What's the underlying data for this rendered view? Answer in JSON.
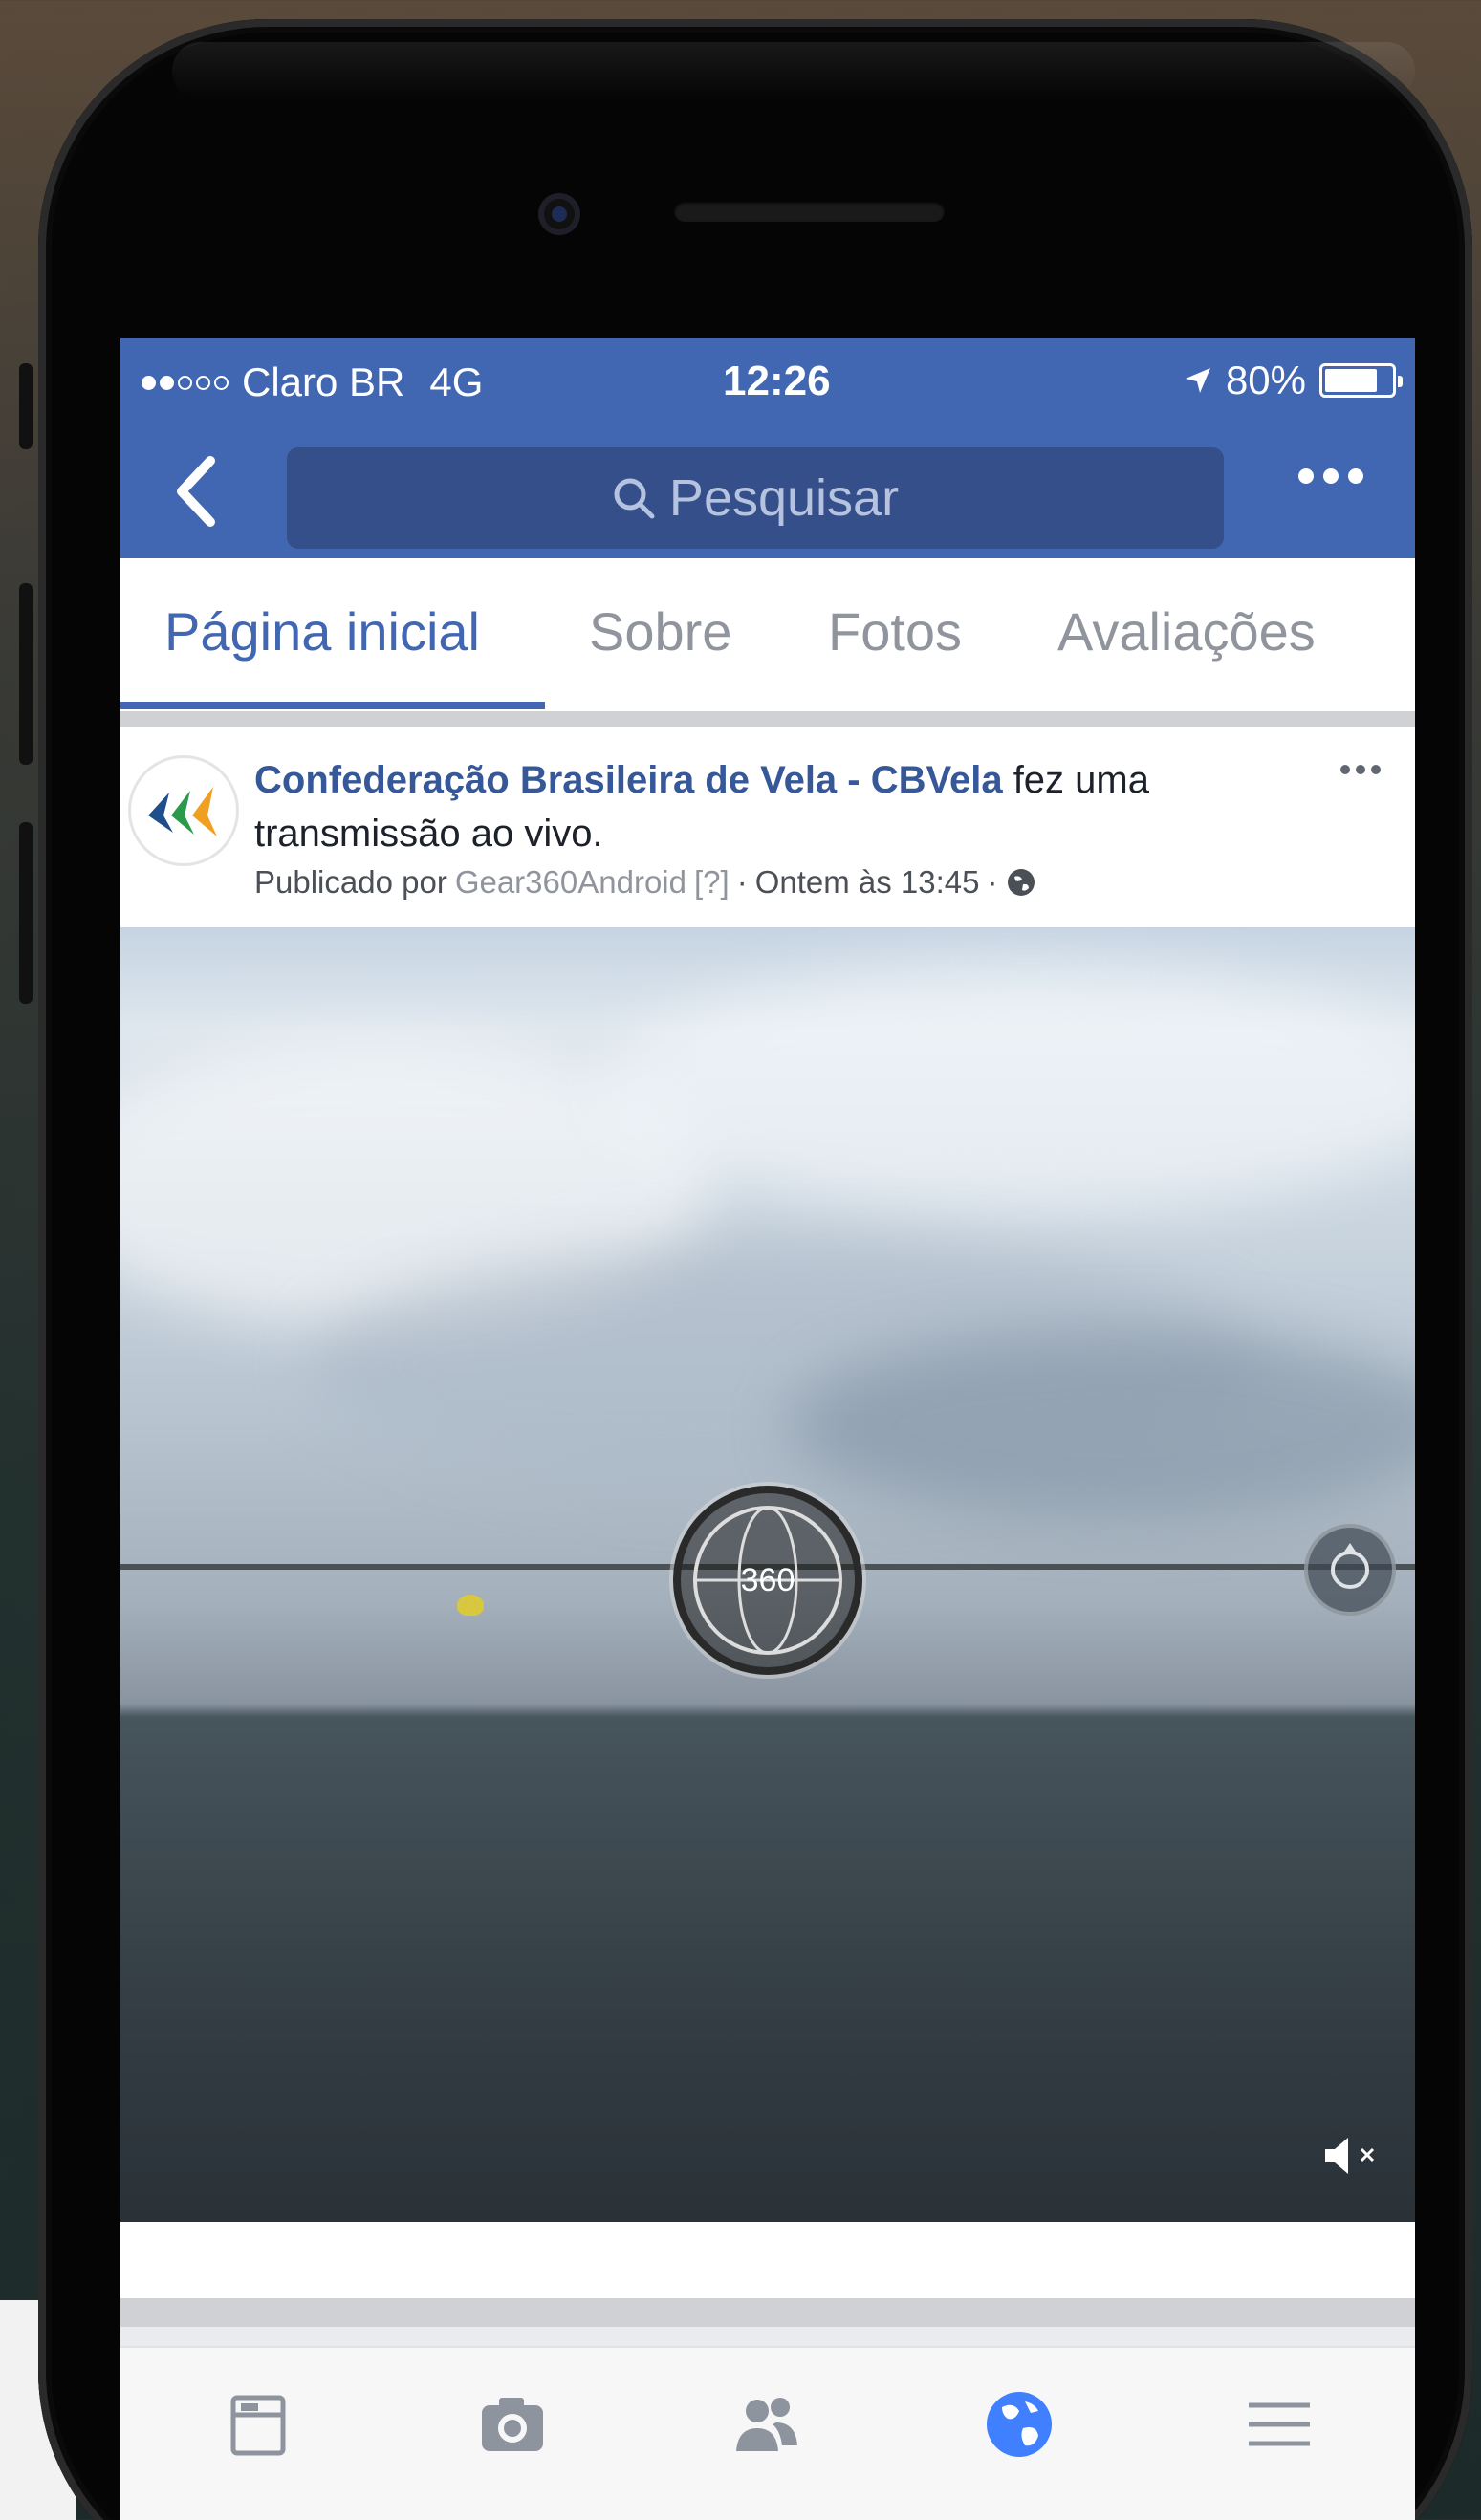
{
  "status_bar": {
    "carrier": "Claro BR",
    "network": "4G",
    "time": "12:26",
    "battery": "80%",
    "battery_level": 0.8
  },
  "nav": {
    "search_placeholder": "Pesquisar"
  },
  "tabs": [
    {
      "label": "Página inicial",
      "active": true
    },
    {
      "label": "Sobre",
      "active": false
    },
    {
      "label": "Fotos",
      "active": false
    },
    {
      "label": "Avaliações",
      "active": false
    }
  ],
  "post": {
    "page_name": "Confederação Brasileira de Vela - CBVela",
    "action_text": " fez uma transmissão ao vivo.",
    "published_by_prefix": "Publicado por",
    "author": "Gear360Android",
    "author_badge": "[?]",
    "separator": "·",
    "timestamp": "Ontem às 13:45"
  },
  "video": {
    "badge_label": "360"
  },
  "bottom_bar": {
    "items": [
      {
        "icon": "news-feed-icon",
        "active": false
      },
      {
        "icon": "camera-icon",
        "active": false
      },
      {
        "icon": "friends-icon",
        "active": false
      },
      {
        "icon": "globe-notifications-icon",
        "active": true
      },
      {
        "icon": "menu-icon",
        "active": false
      }
    ]
  },
  "colors": {
    "facebook_blue": "#4267b2",
    "link_blue": "#365899",
    "active_tab_icon": "#4080ff"
  }
}
